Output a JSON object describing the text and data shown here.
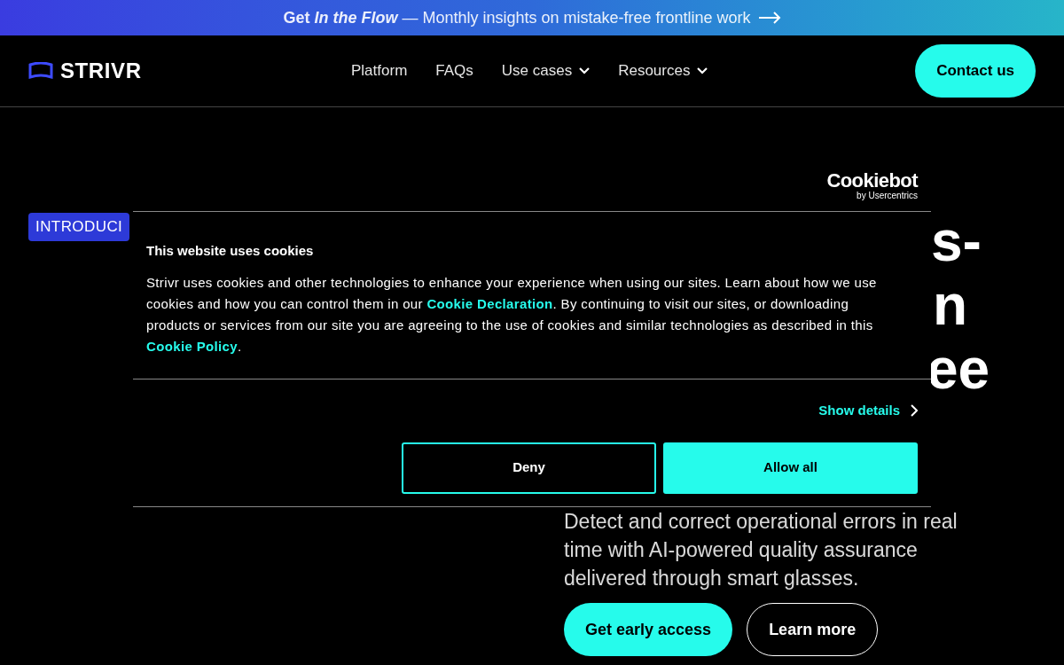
{
  "banner": {
    "lead": "Get",
    "title": "In the Flow",
    "text": "— Monthly insights on mistake-free frontline work"
  },
  "header": {
    "logo": "STRIVR",
    "nav": [
      {
        "label": "Platform",
        "dropdown": false
      },
      {
        "label": "FAQs",
        "dropdown": false
      },
      {
        "label": "Use cases",
        "dropdown": true
      },
      {
        "label": "Resources",
        "dropdown": true
      }
    ],
    "cta": "Contact us"
  },
  "hero": {
    "badge": "INTRODUCI",
    "heading_fragments": [
      "s-",
      "n",
      "ee"
    ],
    "description": "Detect and correct operational errors in real time with AI-powered quality assurance delivered through smart glasses.",
    "buttons": [
      {
        "label": "Get early access",
        "kind": "primary"
      },
      {
        "label": "Learn more",
        "kind": "outline"
      }
    ]
  },
  "cookie_dialog": {
    "brand": "Cookiebot",
    "brand_sub": "by Usercentrics",
    "title": "This website uses cookies",
    "body": "Strivr uses cookies and other technologies to enhance your experience when using our sites. Learn about how we use cookies and how you can control them in our ",
    "link1": "Cookie Declaration",
    "body2": ". By continuing to visit our sites, or downloading products or services from our site you are agreeing to the use of cookies and similar technologies as described in this ",
    "link2": "Cookie Policy",
    "body3": ".",
    "show_details": "Show details",
    "buttons": [
      {
        "label": "Deny",
        "kind": "outline"
      },
      {
        "label": "Allow all",
        "kind": "primary"
      }
    ]
  }
}
